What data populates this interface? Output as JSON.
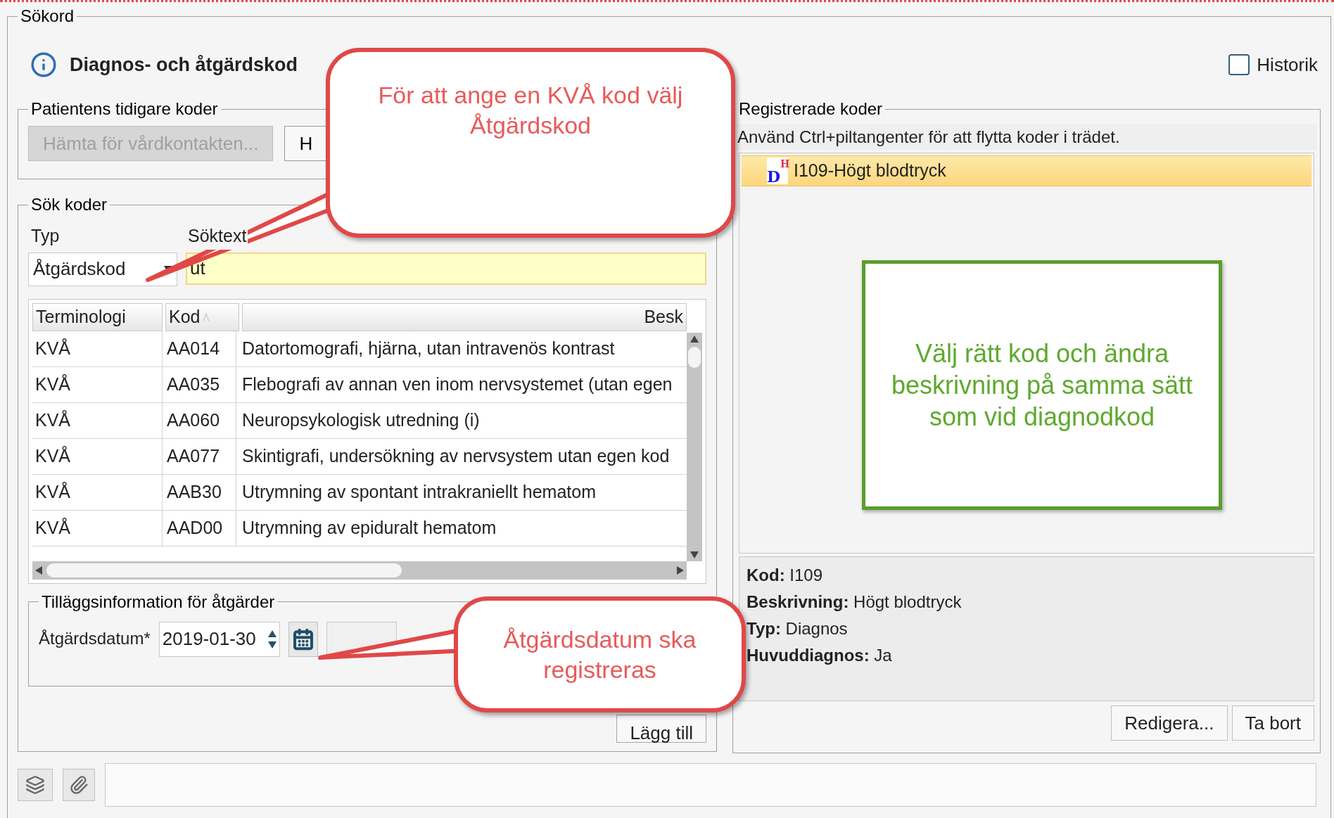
{
  "section_title": "Sökord",
  "header": {
    "title": "Diagnos- och åtgärdskod",
    "history": {
      "label": "Historik",
      "checked": false
    }
  },
  "previous_codes": {
    "title": "Patientens tidigare koder",
    "buttons": [
      {
        "label": "Hämta för vårdkontakten...",
        "disabled": true
      },
      {
        "label": "H",
        "disabled": false
      }
    ]
  },
  "search": {
    "title": "Sök koder",
    "type_label": "Typ",
    "type_value": "Åtgärdskod",
    "text_label": "Söktext",
    "text_value": "ut"
  },
  "table": {
    "columns": [
      {
        "label": "Terminologi",
        "sorted": false
      },
      {
        "label": "Kod",
        "sorted": true
      },
      {
        "label": "Besk",
        "sorted": false
      }
    ],
    "rows": [
      {
        "terminology": "KVÅ",
        "code": "AA014",
        "description": "Datortomografi, hjärna, utan intravenös kontrast"
      },
      {
        "terminology": "KVÅ",
        "code": "AA035",
        "description": "Flebografi av annan ven inom nervsystemet (utan egen"
      },
      {
        "terminology": "KVÅ",
        "code": "AA060",
        "description": "Neuropsykologisk utredning (i)"
      },
      {
        "terminology": "KVÅ",
        "code": "AA077",
        "description": "Skintigrafi, undersökning av nervsystem utan egen kod"
      },
      {
        "terminology": "KVÅ",
        "code": "AAB30",
        "description": "Utrymning av spontant intrakraniellt hematom"
      },
      {
        "terminology": "KVÅ",
        "code": "AAD00",
        "description": "Utrymning av epiduralt hematom"
      }
    ]
  },
  "extra_info": {
    "title": "Tilläggsinformation för åtgärder",
    "date_label": "Åtgärdsdatum*",
    "date_value": "2019-01-30"
  },
  "add_button": "Lägg till",
  "registered": {
    "title": "Registrerade koder",
    "hint": "Använd Ctrl+piltangenter för att flytta koder i trädet.",
    "items": [
      {
        "badge": "D",
        "badge_mark": "H",
        "label": "I109-Högt blodtryck",
        "selected": true
      }
    ],
    "details": [
      "**Kod:** I109",
      "**Beskrivning:** Högt blodtryck",
      "**Typ:** Diagnos",
      "**Huvuddiagnos:** Ja"
    ],
    "buttons": [
      "Redigera...",
      "Ta bort"
    ]
  },
  "annotations": [
    {
      "kind": "callout",
      "text": "För att ange en KVÅ kod välj\nÅtgärdskod"
    },
    {
      "kind": "box",
      "text": "Välj rätt kod och ändra\nbeskrivning på samma sätt\nsom vid diagnodkod"
    },
    {
      "kind": "callout",
      "text": "Åtgärdsdatum ska\nregistreras"
    }
  ]
}
